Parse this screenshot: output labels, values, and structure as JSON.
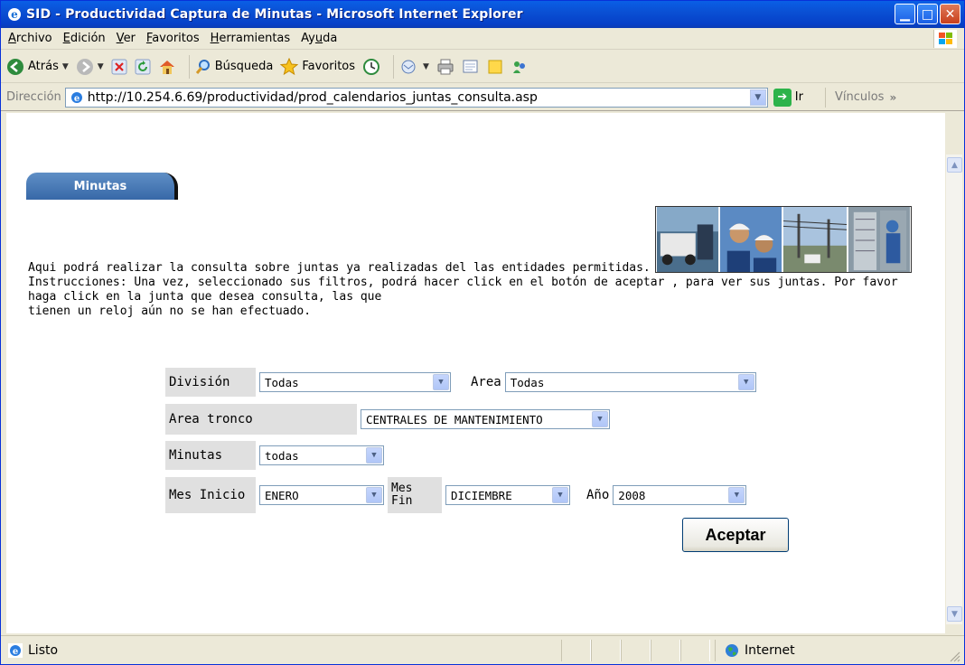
{
  "window": {
    "title": "SID - Productividad Captura de Minutas - Microsoft Internet Explorer"
  },
  "menu": [
    {
      "pre": "",
      "u": "A",
      "post": "rchivo"
    },
    {
      "pre": "",
      "u": "E",
      "post": "dición"
    },
    {
      "pre": "",
      "u": "V",
      "post": "er"
    },
    {
      "pre": "",
      "u": "F",
      "post": "avoritos"
    },
    {
      "pre": "",
      "u": "H",
      "post": "erramientas"
    },
    {
      "pre": "Ay",
      "u": "u",
      "post": "da"
    }
  ],
  "toolbar": {
    "back_label": "Atrás",
    "search_label": "Búsqueda",
    "favorites_label": "Favoritos"
  },
  "address": {
    "label": "Dirección",
    "url": "http://10.254.6.69/productividad/prod_calendarios_juntas_consulta.asp",
    "go_label": "Ir",
    "links_label": "Vínculos",
    "more": "»"
  },
  "page": {
    "tab_label": "Minutas",
    "intro_line1": "Aqui podrá realizar la consulta sobre juntas ya realizadas del las entidades permitidas.",
    "intro_line2": "Instrucciones: Una vez, seleccionado sus filtros, podrá hacer click en el botón de aceptar , para ver sus juntas. Por favor haga click en la junta que desea consulta, las que",
    "intro_line3": "tienen un reloj aún no se han efectuado."
  },
  "form": {
    "division_label": "División",
    "division_value": "Todas",
    "area_label": "Area",
    "area_value": "Todas",
    "area_tronco_label": "Area tronco",
    "area_tronco_value": "CENTRALES DE MANTENIMIENTO",
    "minutas_label": "Minutas",
    "minutas_value": "todas",
    "mes_inicio_label": "Mes Inicio",
    "mes_inicio_value": "ENERO",
    "mes_fin_label_1": "Mes",
    "mes_fin_label_2": "Fin",
    "mes_fin_value": "DICIEMBRE",
    "anio_label": "Año",
    "anio_value": "2008",
    "submit_label": "Aceptar"
  },
  "status": {
    "text": "Listo",
    "zone": "Internet"
  },
  "colors": {
    "titlebar": "#0a50d4",
    "chrome": "#ece9d8",
    "tab": "#3768a8",
    "label_bg": "#e0e0e0"
  }
}
